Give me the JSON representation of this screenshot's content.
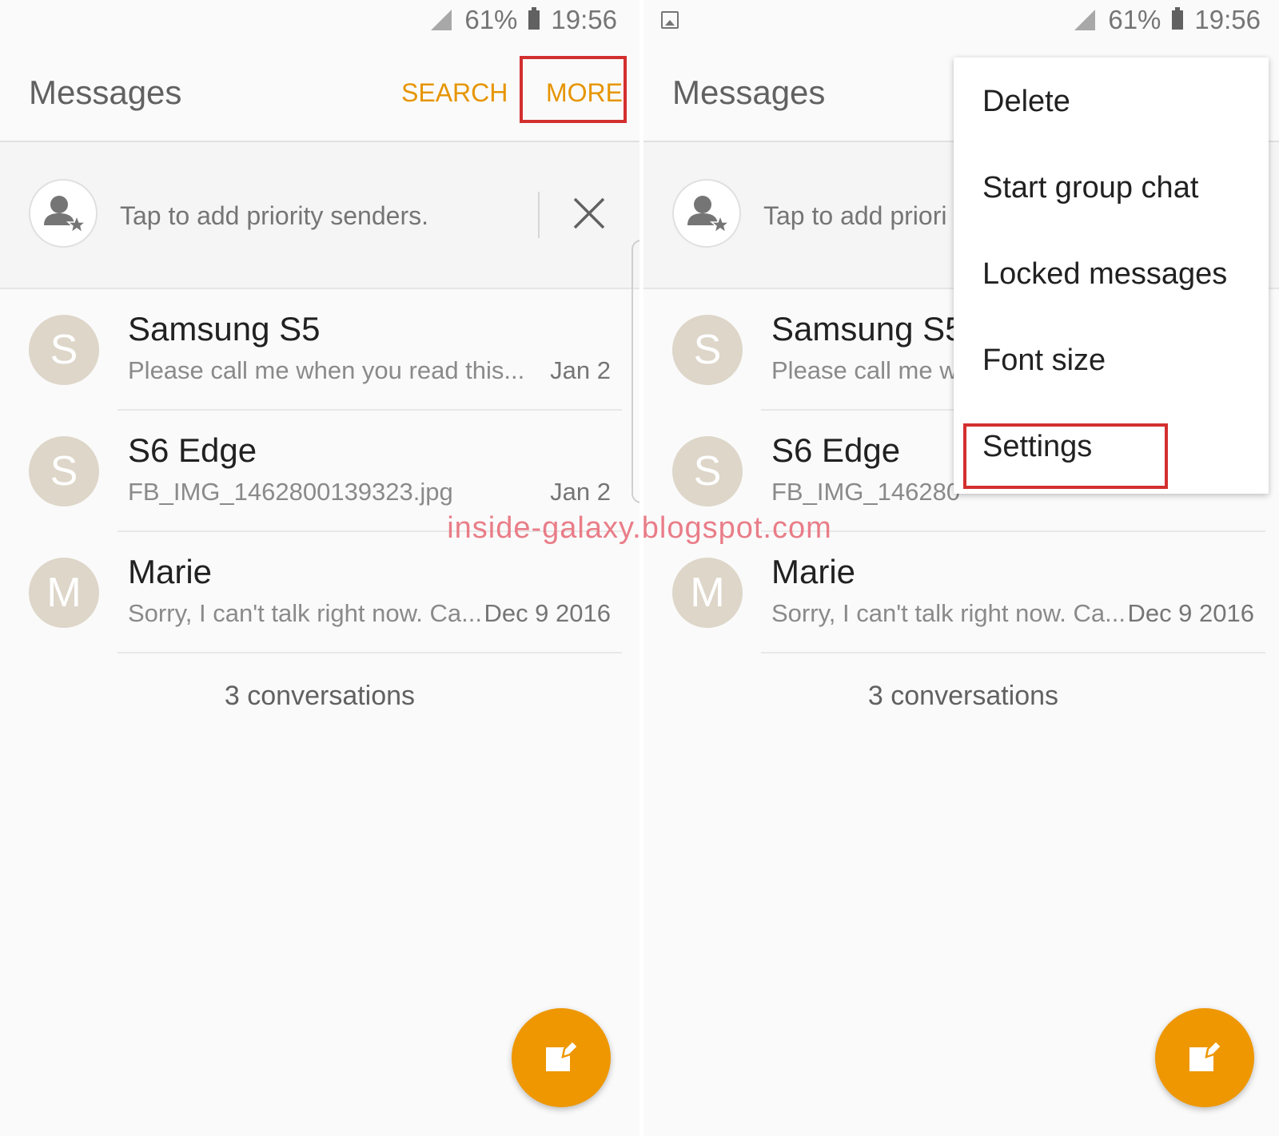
{
  "status_bar": {
    "battery_percent": "61%",
    "time": "19:56"
  },
  "app_bar": {
    "title": "Messages",
    "search_label": "SEARCH",
    "more_label": "MORE"
  },
  "priority": {
    "prompt": "Tap to add priority senders.",
    "prompt_truncated": "Tap to add priori"
  },
  "conversations": [
    {
      "initial": "S",
      "name": "Samsung S5",
      "name_truncated": "Samsung S5",
      "preview": "Please call me when you read this...",
      "preview_truncated": "Please call me w",
      "date": "Jan 2"
    },
    {
      "initial": "S",
      "name": "S6 Edge",
      "preview": "FB_IMG_1462800139323.jpg",
      "preview_truncated": "FB_IMG_146280",
      "date": "Jan 2"
    },
    {
      "initial": "M",
      "name": "Marie",
      "preview": "Sorry, I can't talk right now. Ca...",
      "date": "Dec 9 2016"
    }
  ],
  "conversation_count": "3 conversations",
  "overflow_menu": {
    "items": [
      "Delete",
      "Start group chat",
      "Locked messages",
      "Font size",
      "Settings"
    ]
  },
  "watermark": "inside-galaxy.blogspot.com",
  "colors": {
    "accent": "#e69500",
    "fab": "#ee9700",
    "highlight": "#d32f2f",
    "avatar": "#ddd6c9"
  },
  "icons": [
    "signal-icon",
    "battery-icon",
    "gallery-icon",
    "priority-sender-icon",
    "close-icon",
    "compose-icon"
  ]
}
